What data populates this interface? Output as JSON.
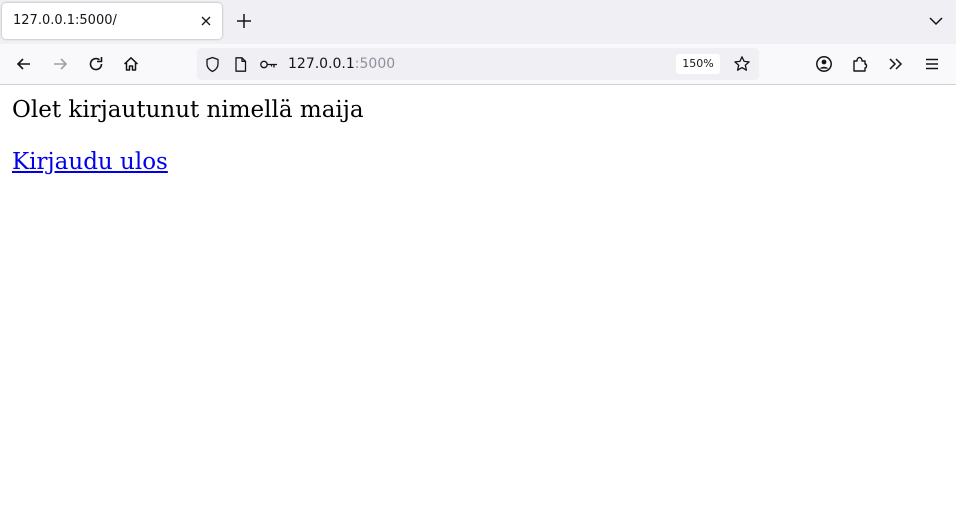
{
  "tab": {
    "title": "127.0.0.1:5000/"
  },
  "urlbar": {
    "host": "127.0.0.1",
    "port": ":5000",
    "zoom": "150%"
  },
  "page": {
    "greeting": "Olet kirjautunut nimellä maija",
    "logout_link": "Kirjaudu ulos"
  },
  "icons": {
    "tab_close": "close-icon",
    "new_tab": "plus-icon",
    "tab_list": "chevron-down-icon",
    "back": "arrow-left-icon",
    "forward": "arrow-right-icon",
    "reload": "reload-icon",
    "home": "home-icon",
    "shield": "shield-icon",
    "page": "page-icon",
    "key": "key-icon",
    "bookmark": "star-icon",
    "account": "account-icon",
    "extensions": "puzzle-icon",
    "overflow": "double-chevron-icon",
    "menu": "hamburger-menu-icon"
  },
  "colors": {
    "link": "#0000ee",
    "tabbar_bg": "#f0f0f4",
    "toolbar_bg": "#f9f9fb",
    "urlbar_bg": "#f0f0f4",
    "port_text": "#8f8f9d"
  }
}
